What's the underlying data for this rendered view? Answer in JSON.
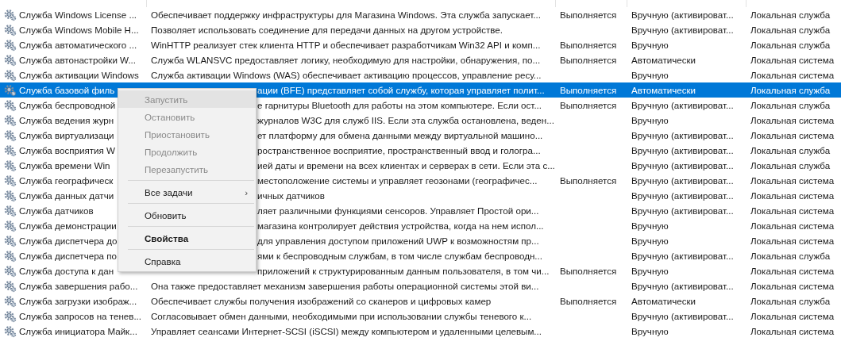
{
  "table": {
    "rows": [
      {
        "name": "Служба Windows License ...",
        "description": "Обеспечивает поддержку инфраструктуры для Магазина Windows. Эта служба запускает...",
        "status": "Выполняется",
        "startup": "Вручную (активироват...",
        "logon": "Локальная служба",
        "selected": false,
        "under_menu": false
      },
      {
        "name": "Служба Windows Mobile H...",
        "description": "Позволяет использовать соединение для передачи данных на другом устройстве.",
        "startup": "Вручную (активироват...",
        "logon": "Локальная служба",
        "selected": false,
        "under_menu": false
      },
      {
        "name": "Служба автоматического ...",
        "description": "WinHTTP реализует стек клиента HTTP и обеспечивает разработчикам Win32 API и комп...",
        "status": "Выполняется",
        "startup": "Вручную",
        "logon": "Локальная служба",
        "selected": false,
        "under_menu": false
      },
      {
        "name": "Служба автонастройки W...",
        "description": "Служба WLANSVC предоставляет логику, необходимую для настройки, обнаружения, по...",
        "status": "Выполняется",
        "startup": "Автоматически",
        "logon": "Локальная система",
        "selected": false,
        "under_menu": false
      },
      {
        "name": "Служба активации Windows",
        "description": "Служба активации Windows (WAS) обеспечивает активацию процессов, управление ресу...",
        "startup": "Вручную",
        "logon": "Локальная система",
        "selected": false,
        "under_menu": false
      },
      {
        "name": "Служба базовой филь",
        "description": "ации (BFE) представляет собой службу, которая управляет полит...",
        "status": "Выполняется",
        "startup": "Автоматически",
        "logon": "Локальная служба",
        "selected": true,
        "under_menu": true
      },
      {
        "name": "Служба беспроводной",
        "description": "е гарнитуры Bluetooth для работы на этом компьютере. Если ост...",
        "status": "Выполняется",
        "startup": "Вручную (активироват...",
        "logon": "Локальная служба",
        "selected": false,
        "under_menu": true
      },
      {
        "name": "Служба ведения журн",
        "description": "журналов W3C для служб IIS. Если эта служба остановлена, веден...",
        "startup": "Вручную",
        "logon": "Локальная система",
        "selected": false,
        "under_menu": true
      },
      {
        "name": "Служба виртуализаци",
        "description": "ет платформу для обмена данными между виртуальной машино...",
        "startup": "Вручную (активироват...",
        "logon": "Локальная система",
        "selected": false,
        "under_menu": true
      },
      {
        "name": "Служба восприятия W",
        "description": "ространственное восприятие, пространственный ввод и гологра...",
        "startup": "Вручную (активироват...",
        "logon": "Локальная служба",
        "selected": false,
        "under_menu": true
      },
      {
        "name": "Служба времени Win",
        "description": "ией даты и времени на всех клиентах и серверах в сети. Если эта с...",
        "startup": "Вручную (активироват...",
        "logon": "Локальная служба",
        "selected": false,
        "under_menu": true
      },
      {
        "name": "Служба географическ",
        "description": "местоположение системы и управляет геозонами (географичес...",
        "status": "Выполняется",
        "startup": "Вручную (активироват...",
        "logon": "Локальная система",
        "selected": false,
        "under_menu": true
      },
      {
        "name": "Служба данных датчи",
        "description": "ичных датчиков",
        "startup": "Вручную (активироват...",
        "logon": "Локальная система",
        "selected": false,
        "under_menu": true
      },
      {
        "name": "Служба датчиков",
        "description": "ляет различными функциями сенсоров. Управляет Простой ори...",
        "startup": "Вручную (активироват...",
        "logon": "Локальная система",
        "selected": false,
        "under_menu": true
      },
      {
        "name": "Служба демонстрации",
        "description": "магазина контролирует действия устройства, когда на нем испол...",
        "startup": "Вручную",
        "logon": "Локальная система",
        "selected": false,
        "under_menu": true
      },
      {
        "name": "Служба диспетчера до",
        "description": "для управления доступом приложений UWP к возможностям пр...",
        "startup": "Вручную",
        "logon": "Локальная система",
        "selected": false,
        "under_menu": true
      },
      {
        "name": "Служба диспетчера по",
        "description": "ями к беспроводным службам, в том числе службам беспроводн...",
        "startup": "Вручную (активироват...",
        "logon": "Локальная служба",
        "selected": false,
        "under_menu": true
      },
      {
        "name": "Служба доступа к дан",
        "description": "приложений к структурированным данным пользователя, в том чи...",
        "status": "Выполняется",
        "startup": "Вручную",
        "logon": "Локальная система",
        "selected": false,
        "under_menu": true
      },
      {
        "name": "Служба завершения рабо...",
        "description": "Она также предоставляет механизм завершения работы операционной системы этой ви...",
        "startup": "Вручную (активироват...",
        "logon": "Локальная система",
        "selected": false,
        "under_menu": false
      },
      {
        "name": "Служба загрузки изображ...",
        "description": "Обеспечивает службы получения изображений со сканеров и цифровых камер",
        "status": "Выполняется",
        "startup": "Автоматически",
        "logon": "Локальная служба",
        "selected": false,
        "under_menu": false
      },
      {
        "name": "Служба запросов на тенев...",
        "description": "Согласовывает обмен данными, необходимыми при использовании службы теневого к...",
        "startup": "Вручную (активироват...",
        "logon": "Локальная система",
        "selected": false,
        "under_menu": false
      },
      {
        "name": "Служба инициатора Майк...",
        "description": "Управляет сеансами Интернет-SCSI (iSCSI) между компьютером и удаленными целевым...",
        "startup": "Вручную",
        "logon": "Локальная система",
        "selected": false,
        "under_menu": false
      }
    ]
  },
  "context_menu": {
    "items": [
      {
        "kind": "item",
        "label": "Запустить",
        "disabled": true,
        "hovered": true,
        "default": false
      },
      {
        "kind": "item",
        "label": "Остановить",
        "disabled": true,
        "hovered": false,
        "default": false
      },
      {
        "kind": "item",
        "label": "Приостановить",
        "disabled": true,
        "hovered": false,
        "default": false
      },
      {
        "kind": "item",
        "label": "Продолжить",
        "disabled": true,
        "hovered": false,
        "default": false
      },
      {
        "kind": "item",
        "label": "Перезапустить",
        "disabled": true,
        "hovered": false,
        "default": false
      },
      {
        "kind": "separator"
      },
      {
        "kind": "item",
        "label": "Все задачи",
        "submenu": "›",
        "disabled": false,
        "hovered": false,
        "default": false
      },
      {
        "kind": "separator"
      },
      {
        "kind": "item",
        "label": "Обновить",
        "disabled": false,
        "hovered": false,
        "default": false
      },
      {
        "kind": "separator"
      },
      {
        "kind": "item",
        "label": "Свойства",
        "disabled": false,
        "hovered": false,
        "default": true
      },
      {
        "kind": "separator"
      },
      {
        "kind": "item",
        "label": "Справка",
        "disabled": false,
        "hovered": false,
        "default": false
      }
    ]
  }
}
